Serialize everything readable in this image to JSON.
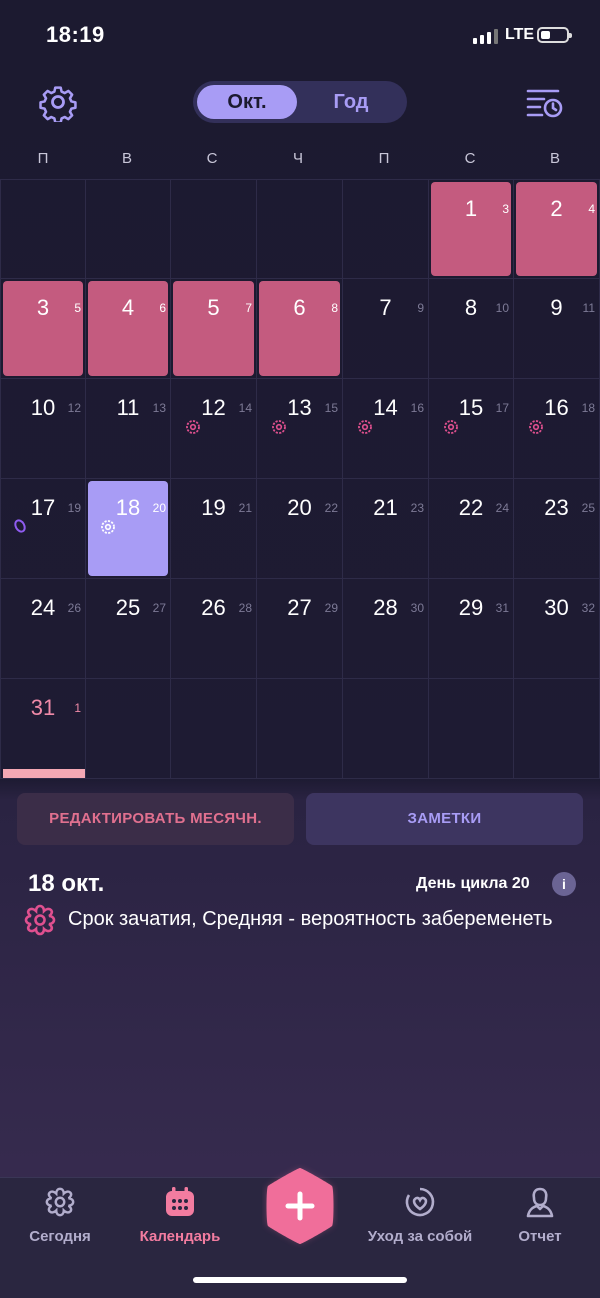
{
  "status_bar": {
    "time": "18:19",
    "network": "LTE"
  },
  "header": {
    "segments": [
      "Окт.",
      "Год"
    ],
    "active_segment": 0
  },
  "weekdays": [
    "П",
    "В",
    "С",
    "Ч",
    "П",
    "С",
    "В"
  ],
  "calendar": {
    "cells": [
      {
        "day": "1",
        "cycle": "3",
        "row": 0,
        "col": 5,
        "state": "period"
      },
      {
        "day": "2",
        "cycle": "4",
        "row": 0,
        "col": 6,
        "state": "period"
      },
      {
        "day": "3",
        "cycle": "5",
        "row": 1,
        "col": 0,
        "state": "period"
      },
      {
        "day": "4",
        "cycle": "6",
        "row": 1,
        "col": 1,
        "state": "period"
      },
      {
        "day": "5",
        "cycle": "7",
        "row": 1,
        "col": 2,
        "state": "period"
      },
      {
        "day": "6",
        "cycle": "8",
        "row": 1,
        "col": 3,
        "state": "period"
      },
      {
        "day": "7",
        "cycle": "9",
        "row": 1,
        "col": 4,
        "state": "normal"
      },
      {
        "day": "8",
        "cycle": "10",
        "row": 1,
        "col": 5,
        "state": "normal"
      },
      {
        "day": "9",
        "cycle": "11",
        "row": 1,
        "col": 6,
        "state": "normal"
      },
      {
        "day": "10",
        "cycle": "12",
        "row": 2,
        "col": 0,
        "state": "normal"
      },
      {
        "day": "11",
        "cycle": "13",
        "row": 2,
        "col": 1,
        "state": "normal"
      },
      {
        "day": "12",
        "cycle": "14",
        "row": 2,
        "col": 2,
        "state": "normal",
        "mark": "fertile"
      },
      {
        "day": "13",
        "cycle": "15",
        "row": 2,
        "col": 3,
        "state": "normal",
        "mark": "fertile"
      },
      {
        "day": "14",
        "cycle": "16",
        "row": 2,
        "col": 4,
        "state": "normal",
        "mark": "fertile"
      },
      {
        "day": "15",
        "cycle": "17",
        "row": 2,
        "col": 5,
        "state": "normal",
        "mark": "fertile"
      },
      {
        "day": "16",
        "cycle": "18",
        "row": 2,
        "col": 6,
        "state": "normal",
        "mark": "fertile"
      },
      {
        "day": "17",
        "cycle": "19",
        "row": 3,
        "col": 0,
        "state": "normal",
        "mark": "ovulation"
      },
      {
        "day": "18",
        "cycle": "20",
        "row": 3,
        "col": 1,
        "state": "today",
        "mark": "fertile"
      },
      {
        "day": "19",
        "cycle": "21",
        "row": 3,
        "col": 2,
        "state": "normal"
      },
      {
        "day": "20",
        "cycle": "22",
        "row": 3,
        "col": 3,
        "state": "normal"
      },
      {
        "day": "21",
        "cycle": "23",
        "row": 3,
        "col": 4,
        "state": "normal"
      },
      {
        "day": "22",
        "cycle": "24",
        "row": 3,
        "col": 5,
        "state": "normal"
      },
      {
        "day": "23",
        "cycle": "25",
        "row": 3,
        "col": 6,
        "state": "normal"
      },
      {
        "day": "24",
        "cycle": "26",
        "row": 4,
        "col": 0,
        "state": "normal"
      },
      {
        "day": "25",
        "cycle": "27",
        "row": 4,
        "col": 1,
        "state": "normal"
      },
      {
        "day": "26",
        "cycle": "28",
        "row": 4,
        "col": 2,
        "state": "normal"
      },
      {
        "day": "27",
        "cycle": "29",
        "row": 4,
        "col": 3,
        "state": "normal"
      },
      {
        "day": "28",
        "cycle": "30",
        "row": 4,
        "col": 4,
        "state": "normal"
      },
      {
        "day": "29",
        "cycle": "31",
        "row": 4,
        "col": 5,
        "state": "normal"
      },
      {
        "day": "30",
        "cycle": "32",
        "row": 4,
        "col": 6,
        "state": "normal"
      },
      {
        "day": "31",
        "cycle": "1",
        "row": 5,
        "col": 0,
        "state": "future"
      }
    ]
  },
  "actions": {
    "edit_label": "РЕДАКТИРОВАТЬ МЕСЯЧН.",
    "notes_label": "ЗАМЕТКИ"
  },
  "day_info": {
    "date": "18 окт.",
    "cycle_day": "День цикла 20",
    "info": "i",
    "fertility_text": "Срок зачатия, Средняя - вероятность забеременеть"
  },
  "colors": {
    "background": "#1c1a30",
    "period": "#c45b7f",
    "today": "#a89cf5",
    "accent_pink": "#f27ca0",
    "fertile_mark": "#e0508f",
    "ovulation_mark": "#8f5cf0",
    "tab_inactive": "#b2adcc"
  },
  "tabbar": {
    "items": [
      {
        "label": "Сегодня",
        "icon": "flower-icon"
      },
      {
        "label": "Календарь",
        "icon": "calendar-icon"
      },
      {
        "label": "Уход за собой",
        "icon": "selfcare-icon"
      },
      {
        "label": "Отчет",
        "icon": "report-icon"
      }
    ],
    "active": 1,
    "fab_icon": "plus-icon"
  }
}
